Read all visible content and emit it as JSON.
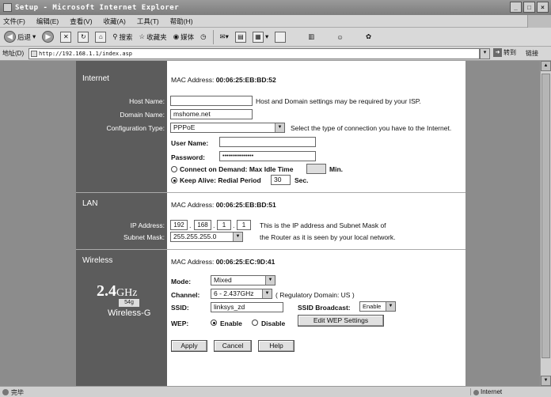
{
  "window": {
    "title": "Setup - Microsoft Internet Explorer"
  },
  "menu": [
    "文件(F)",
    "编辑(E)",
    "查看(V)",
    "收藏(A)",
    "工具(T)",
    "帮助(H)"
  ],
  "toolbar": {
    "back": "后退",
    "search": "搜索",
    "favorites": "收藏夹",
    "media": "媒体"
  },
  "address": {
    "label": "地址(D)",
    "url": "http://192.168.1.1/index.asp",
    "go": "转到",
    "links": "链接"
  },
  "internet": {
    "section": "Internet",
    "mac_label": "MAC Address:",
    "mac": "00:06:25:EB:BD:52",
    "host_label": "Host Name:",
    "host_value": "",
    "host_hint": "Host and Domain settings may be required by your ISP.",
    "domain_label": "Domain Name:",
    "domain_value": "mshome.net",
    "config_label": "Configuration Type:",
    "config_value": "PPPoE",
    "config_hint": "Select the type of connection you have to the Internet.",
    "user_label": "User Name:",
    "user_value": "",
    "pass_label": "Password:",
    "pass_value": "••••••••••••••••",
    "connect_demand": "Connect on Demand: Max Idle Time",
    "idle_value": "",
    "min": "Min.",
    "keep_alive": "Keep Alive: Redial Period",
    "redial_value": "30",
    "sec": "Sec."
  },
  "lan": {
    "section": "LAN",
    "mac_label": "MAC Address:",
    "mac": "00:06:25:EB:BD:51",
    "ip_label": "IP Address:",
    "ip": [
      "192",
      "168",
      "1",
      "1"
    ],
    "ip_hint": "This is the IP address and Subnet Mask of",
    "mask_label": "Subnet Mask:",
    "mask_value": "255.255.255.0",
    "mask_hint": "the Router as it is seen by your local network."
  },
  "wireless": {
    "section": "Wireless",
    "mac_label": "MAC Address:",
    "mac": "00:06:25:EC:9D:41",
    "logo_big": "2.4",
    "logo_ghz": "GHz",
    "logo_badge": "54g",
    "logo_name": "Wireless-G",
    "mode_label": "Mode:",
    "mode_value": "Mixed",
    "channel_label": "Channel:",
    "channel_value": "6 - 2.437GHz",
    "domain_note": "( Regulatory Domain: US )",
    "ssid_label": "SSID:",
    "ssid_value": "linksys_zd",
    "broadcast_label": "SSID Broadcast:",
    "broadcast_value": "Enable",
    "wep_label": "WEP:",
    "wep_enable": "Enable",
    "wep_disable": "Disable",
    "wep_button": "Edit WEP Settings"
  },
  "buttons": {
    "apply": "Apply",
    "cancel": "Cancel",
    "help": "Help"
  },
  "status": {
    "text": "完毕",
    "zone": "Internet"
  }
}
